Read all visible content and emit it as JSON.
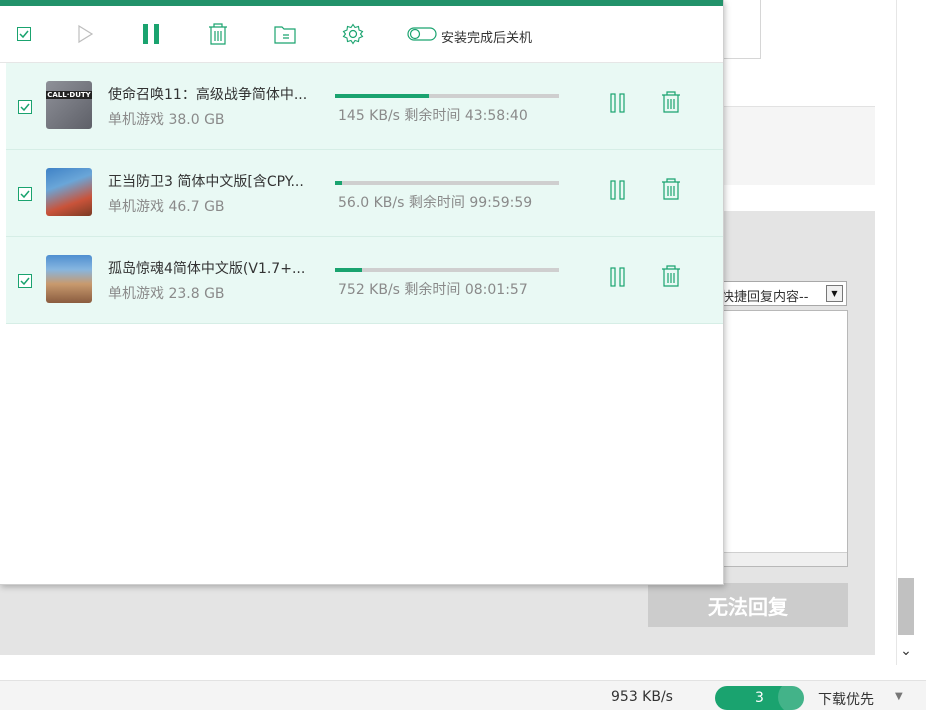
{
  "toolbar": {
    "icons": [
      "checkbox-icon",
      "play-icon",
      "pause-icon",
      "trash-icon",
      "folder-icon",
      "gear-icon",
      "toggle-icon"
    ],
    "shutdown_label": "安装完成后关机"
  },
  "downloads": [
    {
      "title": "使命召唤11：高级战争简体中...",
      "subtitle": "单机游戏  38.0 GB",
      "status": "145 KB/s  剩余时间 43:58:40",
      "progress": 0.42,
      "thumb_label": "CALL·DUTY",
      "thumb_colors": [
        "#8f9199",
        "#5e6068"
      ]
    },
    {
      "title": "正当防卫3  简体中文版[含CPY...",
      "subtitle": "单机游戏  46.7 GB",
      "status": "56.0 KB/s  剩余时间 99:59:59",
      "progress": 0.03,
      "thumb_label": "",
      "thumb_colors": [
        "#3f82c6",
        "#c9533a"
      ]
    },
    {
      "title": "孤岛惊魂4简体中文版(V1.7+...",
      "subtitle": "单机游戏  23.8 GB",
      "status": "752 KB/s  剩余时间 08:01:57",
      "progress": 0.12,
      "thumb_label": "",
      "thumb_colors": [
        "#4f8fd0",
        "#c89a6e"
      ]
    }
  ],
  "background": {
    "reply_select": "快捷回复内容--",
    "reply_button": "无法回复"
  },
  "status_bar": {
    "total_speed": "953 KB/s",
    "active_count": "3",
    "priority": "下载优先"
  },
  "colors": {
    "accent": "#1aa36f",
    "top_bar": "#22926a",
    "row_bg": "#e9f9f4"
  }
}
